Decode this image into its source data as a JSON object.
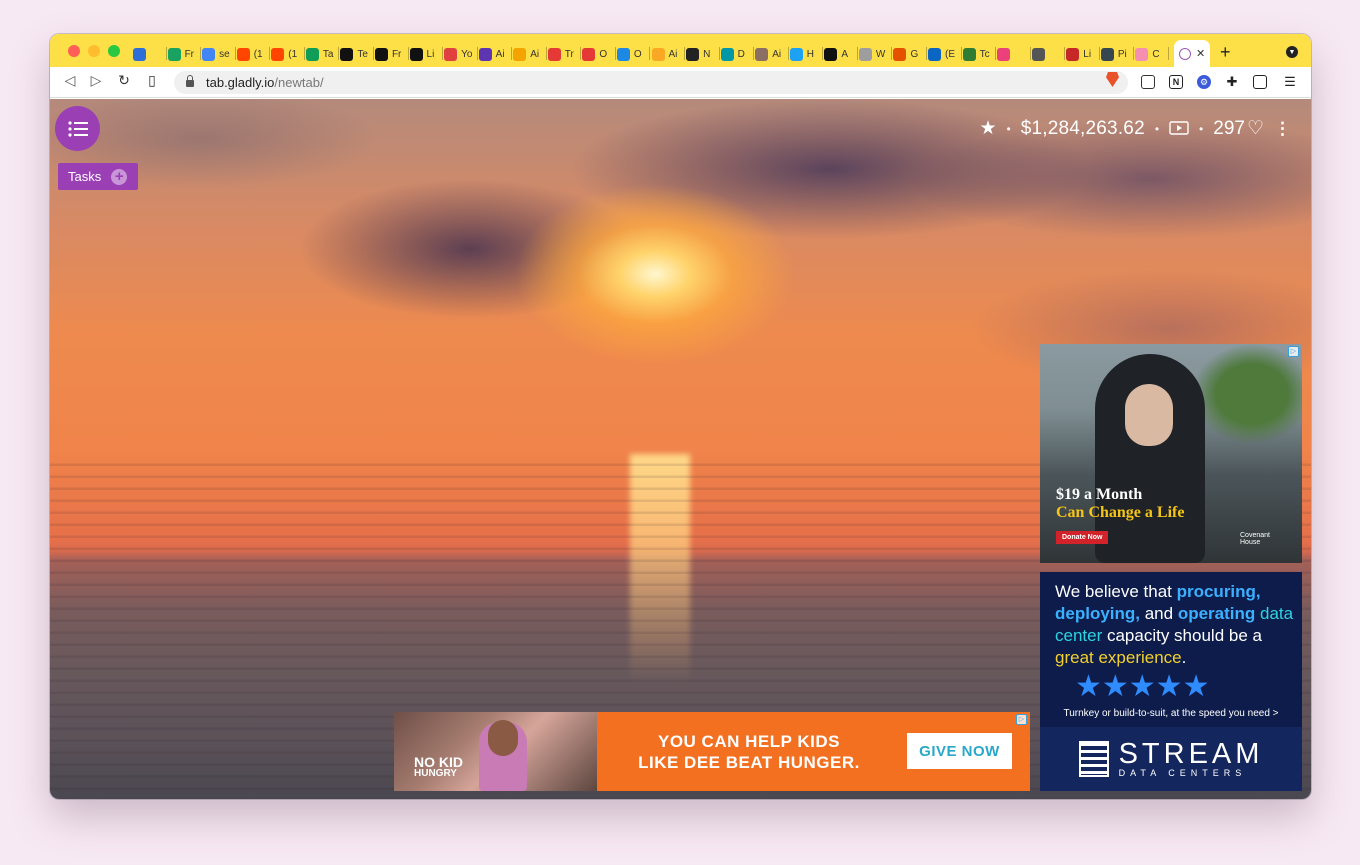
{
  "browser": {
    "tabs": [
      {
        "icon": "grid-icon",
        "label": "",
        "color": "#2d6fd6"
      },
      {
        "icon": "bars-icon",
        "label": "Fr",
        "color": "#1aa260"
      },
      {
        "icon": "google-icon",
        "label": "se",
        "color": "#4285f4"
      },
      {
        "icon": "reddit-icon",
        "label": "(1",
        "color": "#ff4500"
      },
      {
        "icon": "reddit-icon",
        "label": "(1",
        "color": "#ff4500"
      },
      {
        "icon": "plus-green-icon",
        "label": "Ta",
        "color": "#0f9d58"
      },
      {
        "icon": "medium-icon",
        "label": "Te",
        "color": "#111111"
      },
      {
        "icon": "medium-icon",
        "label": "Fr",
        "color": "#111111"
      },
      {
        "icon": "medium-icon",
        "label": "Li",
        "color": "#111111"
      },
      {
        "icon": "record-icon",
        "label": "Yo",
        "color": "#e0413e"
      },
      {
        "icon": "chart-icon",
        "label": "Ai",
        "color": "#5e35b1"
      },
      {
        "icon": "colorful-icon",
        "label": "Ai",
        "color": "#f4a300"
      },
      {
        "icon": "speech-icon",
        "label": "Tr",
        "color": "#e53935"
      },
      {
        "icon": "speech-icon",
        "label": "O",
        "color": "#e53935"
      },
      {
        "icon": "cup-icon",
        "label": "O",
        "color": "#1e88e5"
      },
      {
        "icon": "bar-chart-icon",
        "label": "Ai",
        "color": "#f9a825"
      },
      {
        "icon": "x-circle-icon",
        "label": "N",
        "color": "#222222"
      },
      {
        "icon": "star-circle-icon",
        "label": "D",
        "color": "#0097a7"
      },
      {
        "icon": "globe-icon",
        "label": "Ai",
        "color": "#8d6e63"
      },
      {
        "icon": "twitter-icon",
        "label": "H",
        "color": "#1da1f2"
      },
      {
        "icon": "nyt-icon",
        "label": "A",
        "color": "#111111"
      },
      {
        "icon": "key-icon",
        "label": "W",
        "color": "#9e9e9e"
      },
      {
        "icon": "square-icon",
        "label": "G",
        "color": "#e65100"
      },
      {
        "icon": "linkedin-icon",
        "label": "(E",
        "color": "#0a66c2"
      },
      {
        "icon": "diamond-icon",
        "label": "Tc",
        "color": "#2e7d32"
      },
      {
        "icon": "flower-icon",
        "label": "",
        "color": "#ec407a"
      },
      {
        "icon": "dot-icon",
        "label": "",
        "color": "#555555"
      },
      {
        "icon": "pie-icon",
        "label": "Li",
        "color": "#c62828"
      },
      {
        "icon": "p-icon",
        "label": "Pi",
        "color": "#37474f"
      },
      {
        "icon": "circle-icon",
        "label": "C",
        "color": "#f48fb1"
      }
    ],
    "new_tab_label": "+",
    "url_host": "tab.gladly.io",
    "url_path": "/newtab/"
  },
  "page": {
    "tasks_label": "Tasks",
    "tasks_add": "+",
    "money_raised": "$1,284,263.62",
    "hearts_count": "297",
    "dot": "•"
  },
  "ads": {
    "covenant": {
      "headline": "$19 a Month",
      "subline": "Can Change a Life",
      "button": "Donate Now",
      "logo": "Covenant House"
    },
    "stream": {
      "text_1": "We believe that ",
      "text_2": "procuring,",
      "text_3": "deploying,",
      "text_4": " and ",
      "text_5": "operating",
      "text_6": "data center",
      "text_7": " capacity should be a ",
      "text_8": "great experience",
      "text_9": ".",
      "stars": "★★★★★",
      "tagline": "Turnkey or build-to-suit, at the speed you need >",
      "logo_name": "STREAM",
      "logo_sub": "DATA CENTERS"
    },
    "nokid": {
      "brand_1": "NO KID",
      "brand_2": "HUNGRY",
      "text_line1": "YOU CAN HELP KIDS",
      "text_line2": "LIKE DEE BEAT HUNGER.",
      "button": "GIVE NOW"
    },
    "choice_glyph": "▷"
  },
  "colors": {
    "tabstrip": "#fde047",
    "tab_accent": "#9b3fb5"
  }
}
